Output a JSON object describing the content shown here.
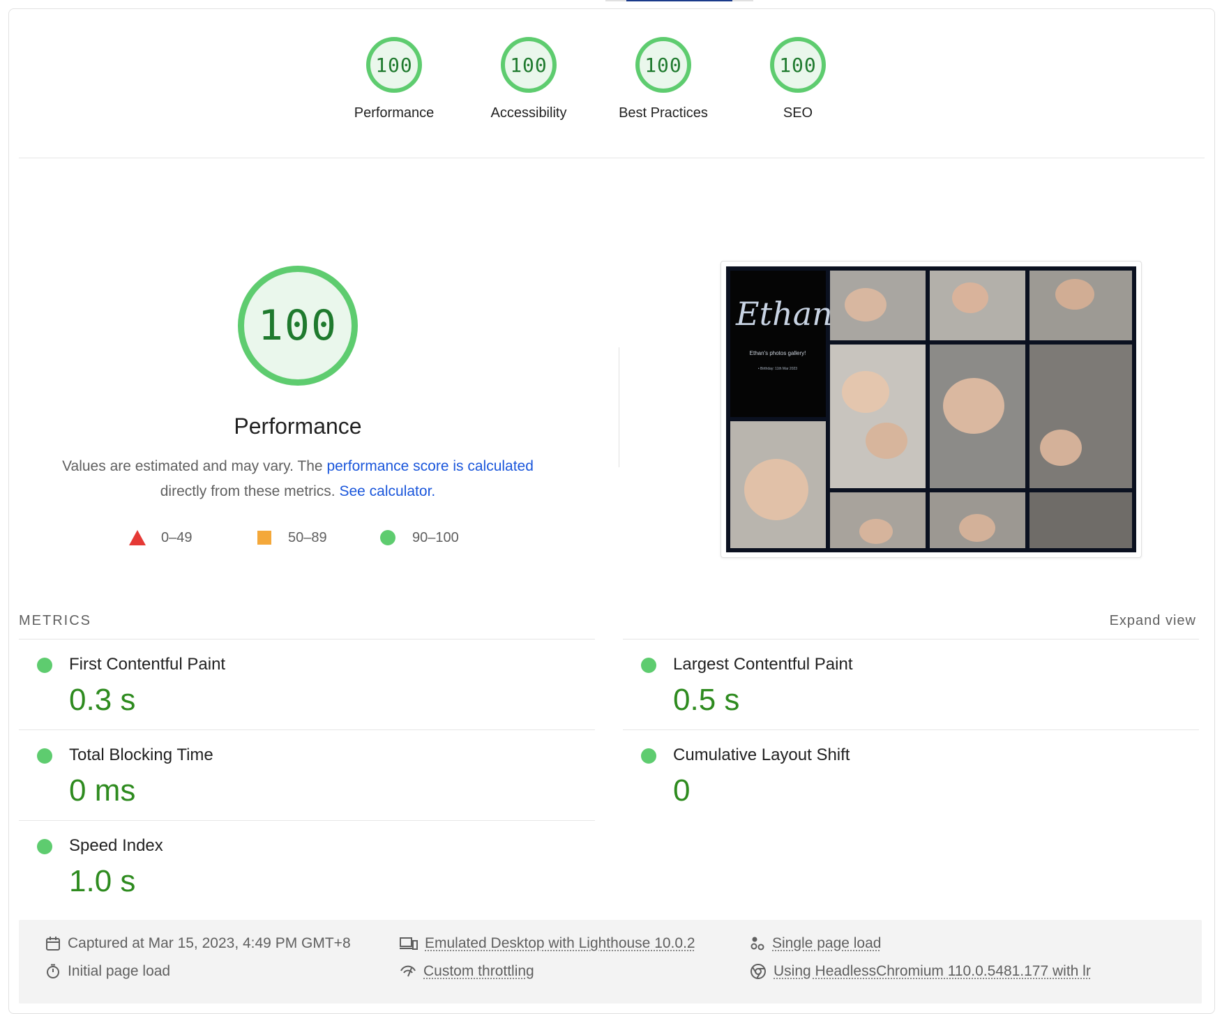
{
  "summary": {
    "gauges": [
      {
        "score": "100",
        "label": "Performance"
      },
      {
        "score": "100",
        "label": "Accessibility"
      },
      {
        "score": "100",
        "label": "Best Practices"
      },
      {
        "score": "100",
        "label": "SEO"
      }
    ]
  },
  "performance": {
    "score": "100",
    "title": "Performance",
    "desc_prefix": "Values are estimated and may vary. The ",
    "desc_link": "performance score is calculated",
    "desc_middle": "directly from these metrics. ",
    "desc_calc_link": "See calculator.",
    "legend": [
      {
        "icon": "triangle-fail-icon",
        "range": "0–49",
        "color": "#e53935"
      },
      {
        "icon": "square-average-icon",
        "range": "50–89",
        "color": "#f4a83a"
      },
      {
        "icon": "circle-pass-icon",
        "range": "90–100",
        "color": "#5ecc6f"
      }
    ]
  },
  "screenshot": {
    "heading": "Ethan",
    "subtitle": "Ethan's photos gallery!",
    "birthday": "• Birthday: 11th Mar 2023"
  },
  "metrics": {
    "heading": "METRICS",
    "expand_label": "Expand view",
    "items": [
      {
        "name": "First Contentful Paint",
        "value": "0.3 s"
      },
      {
        "name": "Largest Contentful Paint",
        "value": "0.5 s"
      },
      {
        "name": "Total Blocking Time",
        "value": "0 ms"
      },
      {
        "name": "Cumulative Layout Shift",
        "value": "0"
      },
      {
        "name": "Speed Index",
        "value": "1.0 s"
      }
    ]
  },
  "footer": {
    "captured": "Captured at Mar 15, 2023, 4:49 PM GMT+8",
    "initial_load": "Initial page load",
    "emulated": "Emulated Desktop with Lighthouse 10.0.2",
    "throttling": "Custom throttling",
    "single_page": "Single page load",
    "browser": "Using HeadlessChromium 110.0.5481.177 with lr"
  },
  "colors": {
    "pass": "#5ecc6f",
    "pass_text": "#2e8b1f",
    "link": "#1a56db"
  }
}
